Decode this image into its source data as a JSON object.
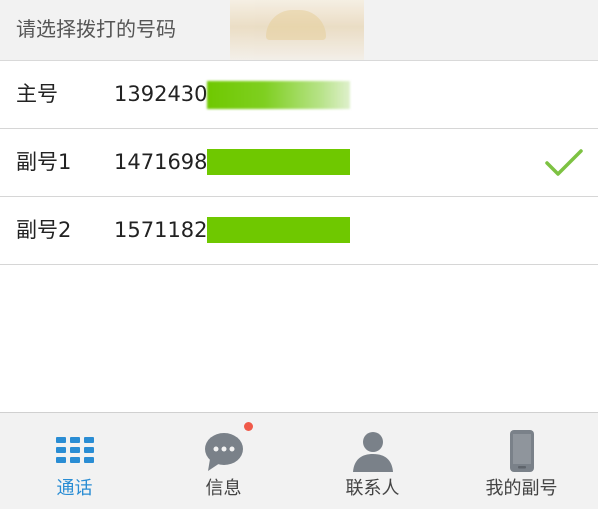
{
  "header": {
    "title": "请选择拨打的号码"
  },
  "numbers": [
    {
      "label": "主号",
      "number": "1392430",
      "selected": false
    },
    {
      "label": "副号1",
      "number": "1471698",
      "selected": true
    },
    {
      "label": "副号2",
      "number": "1571182",
      "selected": false
    }
  ],
  "tabs": [
    {
      "label": "通话",
      "icon": "dialpad-icon",
      "active": true
    },
    {
      "label": "信息",
      "icon": "chat-bubble-icon",
      "active": false,
      "badge": true
    },
    {
      "label": "联系人",
      "icon": "person-icon",
      "active": false
    },
    {
      "label": "我的副号",
      "icon": "phone-icon",
      "active": false
    }
  ],
  "colors": {
    "accent": "#2a8dd4",
    "check": "#7dc242",
    "badge": "#f05a4a",
    "icon_gray": "#7a8189",
    "redaction": "#6fc800"
  }
}
